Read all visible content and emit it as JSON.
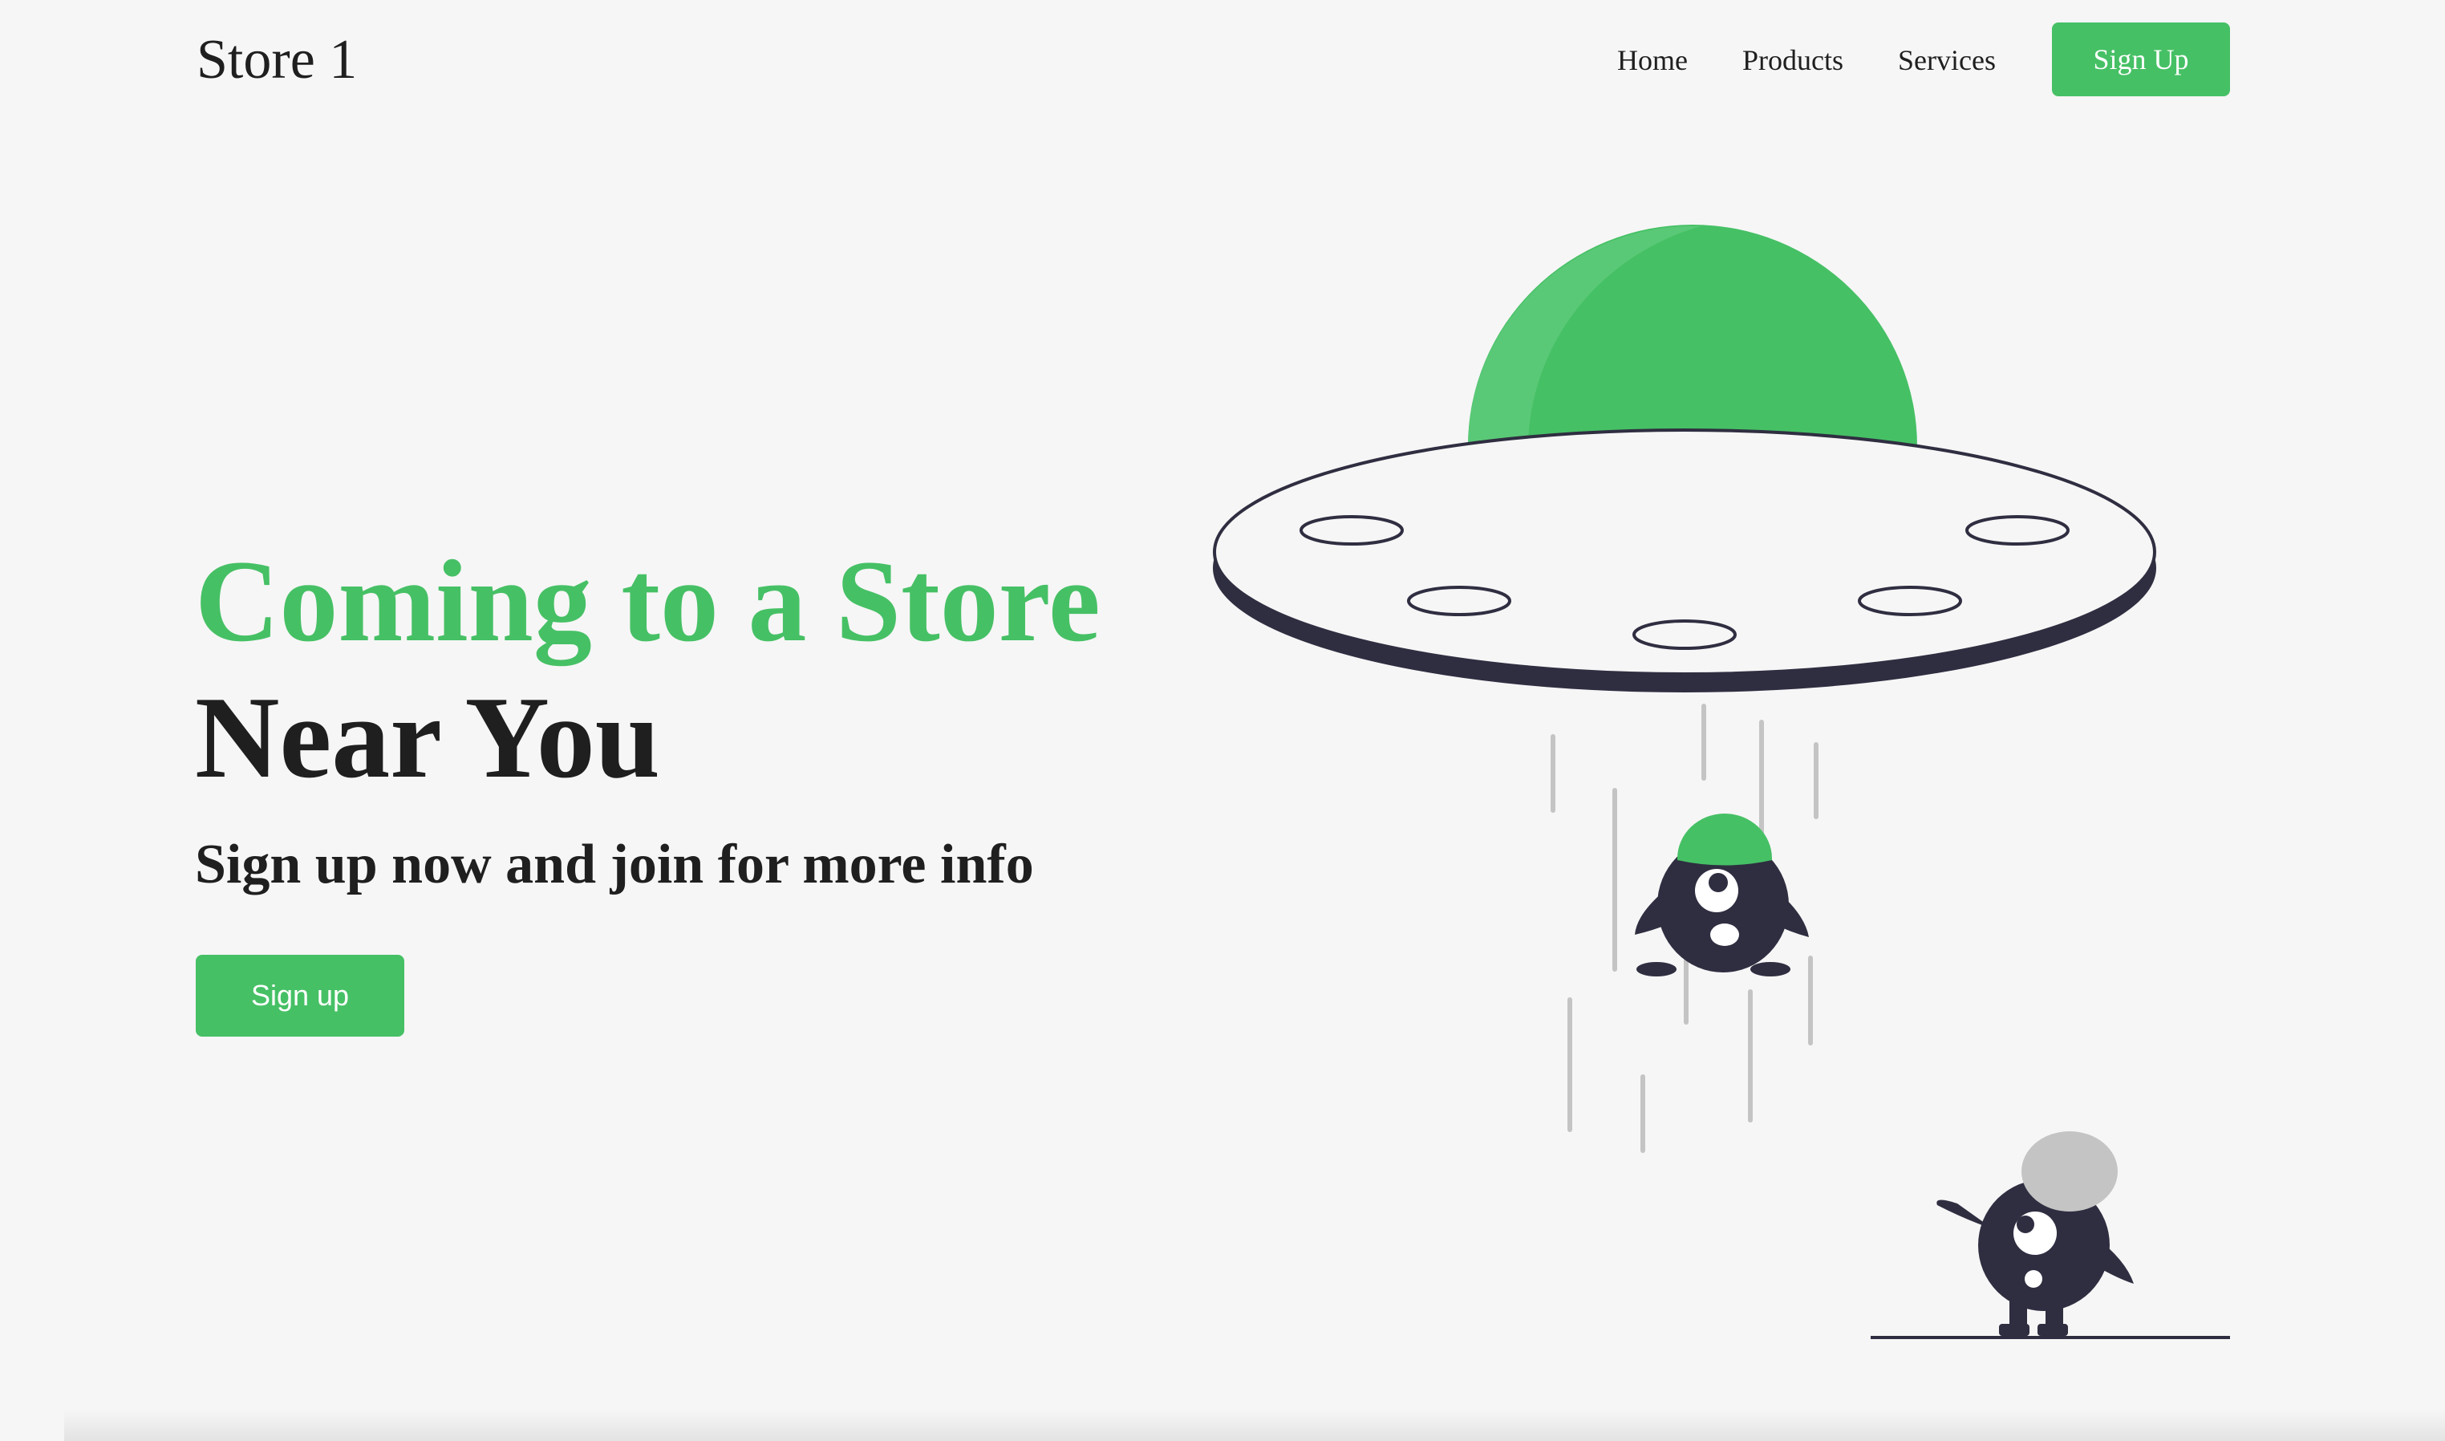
{
  "navbar": {
    "brand": "Store 1",
    "links": [
      {
        "label": "Home"
      },
      {
        "label": "Products"
      },
      {
        "label": "Services"
      }
    ],
    "signup_label": "Sign Up"
  },
  "hero": {
    "title_line1": "Coming to a Store",
    "title_line2": "Near You",
    "subtitle": "Sign up now and join for more info",
    "button_label": "Sign up"
  },
  "illustration": {
    "name": "ufo-abduction-illustration",
    "icons": [
      "ufo-icon",
      "alien-abducted-icon",
      "alien-standing-icon"
    ]
  },
  "colors": {
    "accent": "#46c065",
    "accent_light": "#5ac977",
    "dark": "#2f2e41",
    "background": "#f6f6f6",
    "beam": "#c4c4c4",
    "text": "#1f1f1f"
  }
}
